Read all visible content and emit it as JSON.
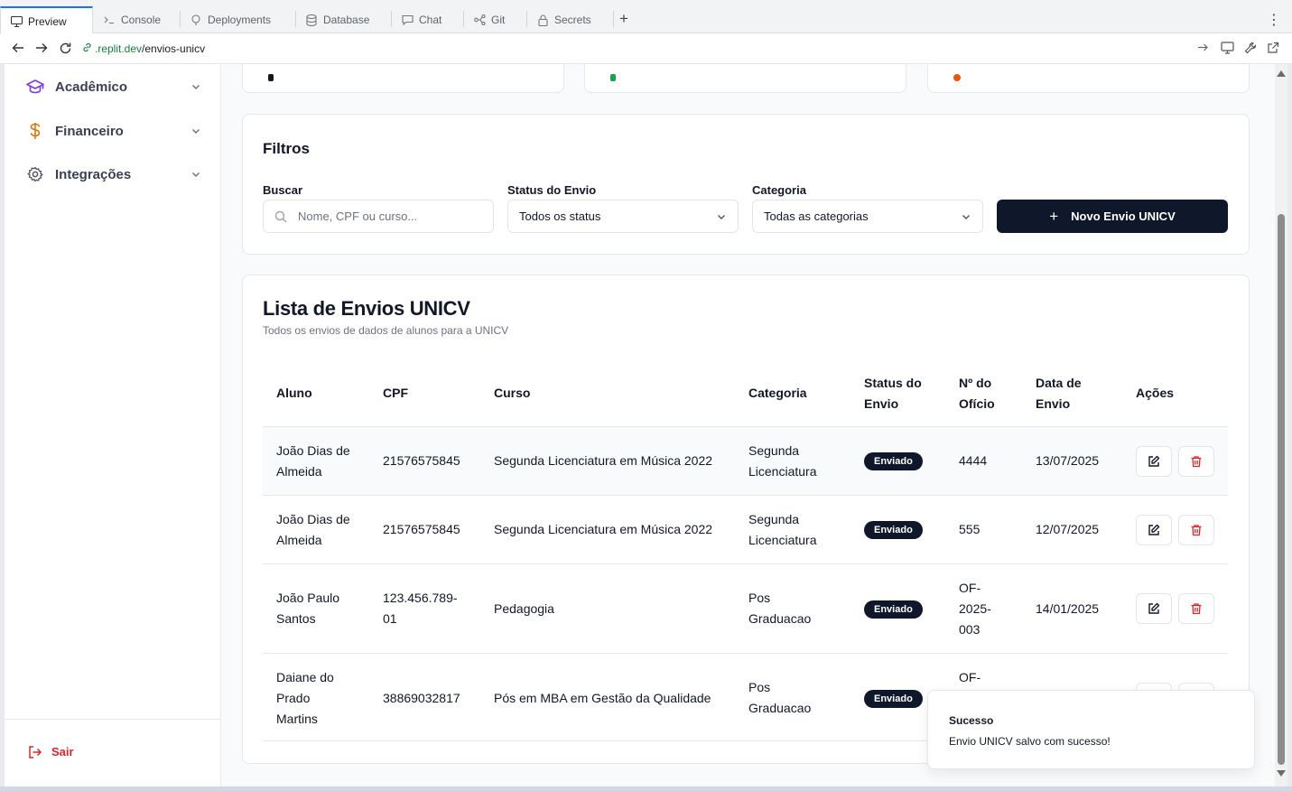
{
  "browser": {
    "tabs": [
      {
        "label": "Preview",
        "icon": "monitor-icon"
      },
      {
        "label": "Console",
        "icon": "terminal-icon"
      },
      {
        "label": "Deployments",
        "icon": "deploy-icon"
      },
      {
        "label": "Database",
        "icon": "database-icon"
      },
      {
        "label": "Chat",
        "icon": "chat-icon"
      },
      {
        "label": "Git",
        "icon": "git-icon"
      },
      {
        "label": "Secrets",
        "icon": "lock-icon"
      }
    ],
    "url_host": ".replit.dev",
    "url_path": "/envios-unicv"
  },
  "sidebar": {
    "items": [
      {
        "label": "Acadêmico",
        "icon": "graduation-cap-icon",
        "color": "#7c3aed"
      },
      {
        "label": "Financeiro",
        "icon": "dollar-icon",
        "color": "#d97706"
      },
      {
        "label": "Integrações",
        "icon": "gear-icon",
        "color": "#4b5563"
      }
    ],
    "logout_label": "Sair"
  },
  "filters": {
    "title": "Filtros",
    "search_label": "Buscar",
    "search_placeholder": "Nome, CPF ou curso...",
    "status_label": "Status do Envio",
    "status_value": "Todos os status",
    "category_label": "Categoria",
    "category_value": "Todas as categorias",
    "new_button": "Novo Envio UNICV"
  },
  "list": {
    "title": "Lista de Envios UNICV",
    "subtitle": "Todos os envios de dados de alunos para a UNICV",
    "columns": {
      "aluno": "Aluno",
      "cpf": "CPF",
      "curso": "Curso",
      "categoria": "Categoria",
      "status_1": "Status do",
      "status_2": "Envio",
      "oficio_1": "Nº do",
      "oficio_2": "Ofício",
      "data_1": "Data de",
      "data_2": "Envio",
      "acoes": "Ações"
    },
    "rows": [
      {
        "aluno_1": "João Dias de",
        "aluno_2": "Almeida",
        "aluno_3": "",
        "cpf_1": "21576575845",
        "cpf_2": "",
        "curso": "Segunda Licenciatura em Música 2022",
        "cat_1": "Segunda",
        "cat_2": "Licenciatura",
        "status": "Enviado",
        "of_1": "4444",
        "of_2": "",
        "of_3": "",
        "data": "13/07/2025"
      },
      {
        "aluno_1": "João Dias de",
        "aluno_2": "Almeida",
        "aluno_3": "",
        "cpf_1": "21576575845",
        "cpf_2": "",
        "curso": "Segunda Licenciatura em Música 2022",
        "cat_1": "Segunda",
        "cat_2": "Licenciatura",
        "status": "Enviado",
        "of_1": "555",
        "of_2": "",
        "of_3": "",
        "data": "12/07/2025"
      },
      {
        "aluno_1": "João Paulo",
        "aluno_2": "Santos",
        "aluno_3": "",
        "cpf_1": "123.456.789-",
        "cpf_2": "01",
        "curso": "Pedagogia",
        "cat_1": "Pos",
        "cat_2": "Graduacao",
        "status": "Enviado",
        "of_1": "OF-",
        "of_2": "2025-",
        "of_3": "003",
        "data": "14/01/2025"
      },
      {
        "aluno_1": "Daiane do",
        "aluno_2": "Prado",
        "aluno_3": "Martins",
        "cpf_1": "38869032817",
        "cpf_2": "",
        "curso": "Pós em MBA em Gestão da Qualidade",
        "cat_1": "Pos",
        "cat_2": "Graduacao",
        "status": "Enviado",
        "of_1": "OF-",
        "of_2": "",
        "of_3": "",
        "data": ""
      }
    ]
  },
  "toast": {
    "title": "Sucesso",
    "message": "Envio UNICV salvo com sucesso!"
  },
  "colors": {
    "primary": "#0f172a",
    "danger": "#dc2626",
    "stat_dots": [
      "#111827",
      "#16a34a",
      "#ea580c"
    ]
  }
}
